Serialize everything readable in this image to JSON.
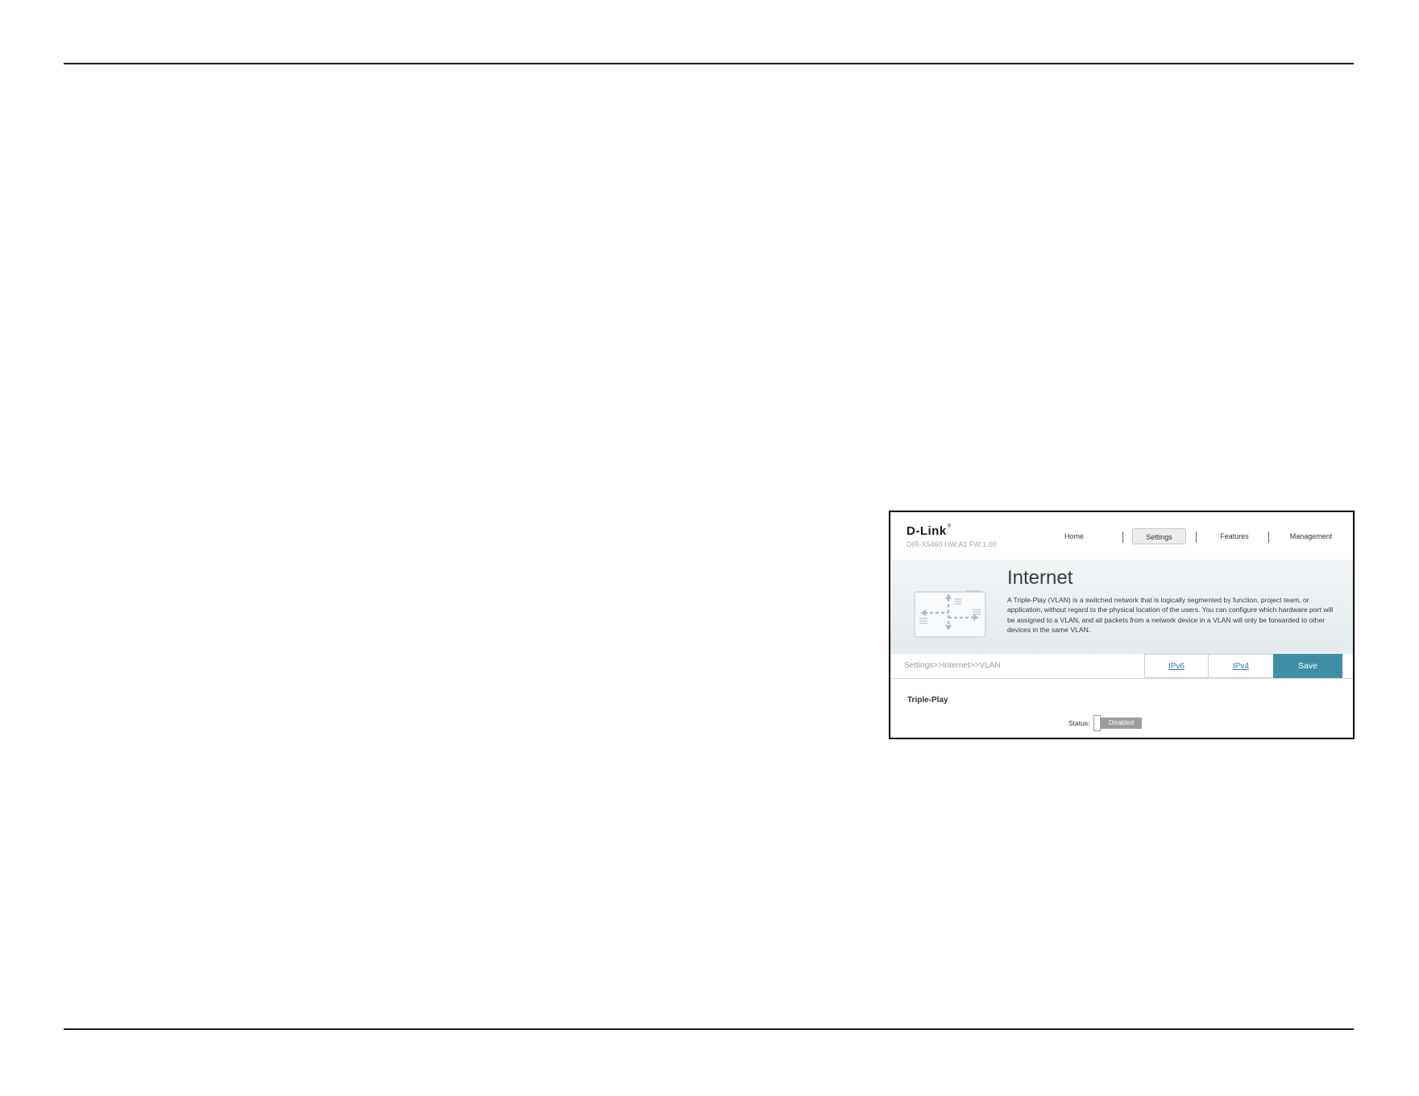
{
  "brand": {
    "name": "D-Link",
    "registered_mark": "®",
    "model_info": "DIR-X5460 HW:A1 FW:1.00"
  },
  "nav": {
    "items": [
      {
        "label": "Home",
        "active": false
      },
      {
        "label": "Settings",
        "active": true
      },
      {
        "label": "Features",
        "active": false
      },
      {
        "label": "Management",
        "active": false
      }
    ]
  },
  "banner": {
    "title": "Internet",
    "illustration_icon": "network-diagram-icon",
    "description": "A Triple-Play (VLAN) is a switched network that is logically segmented by function, project team, or application, without regard to the physical location of the users. You can configure which hardware port will be assigned to a VLAN, and all packets from a network device in a VLAN will only be forwarded to other devices in the same VLAN."
  },
  "toolbar": {
    "breadcrumb": "Settings>>Internet>>VLAN",
    "ipv6_label": "IPv6",
    "ipv4_label": "IPv4",
    "save_label": "Save"
  },
  "content": {
    "section_title": "Triple-Play",
    "status_label": "Status:",
    "status_value": "Disabled"
  },
  "colors": {
    "accent": "#3e8fa5",
    "link": "#2a7fb5",
    "toggle_off": "#9d9d9d"
  }
}
